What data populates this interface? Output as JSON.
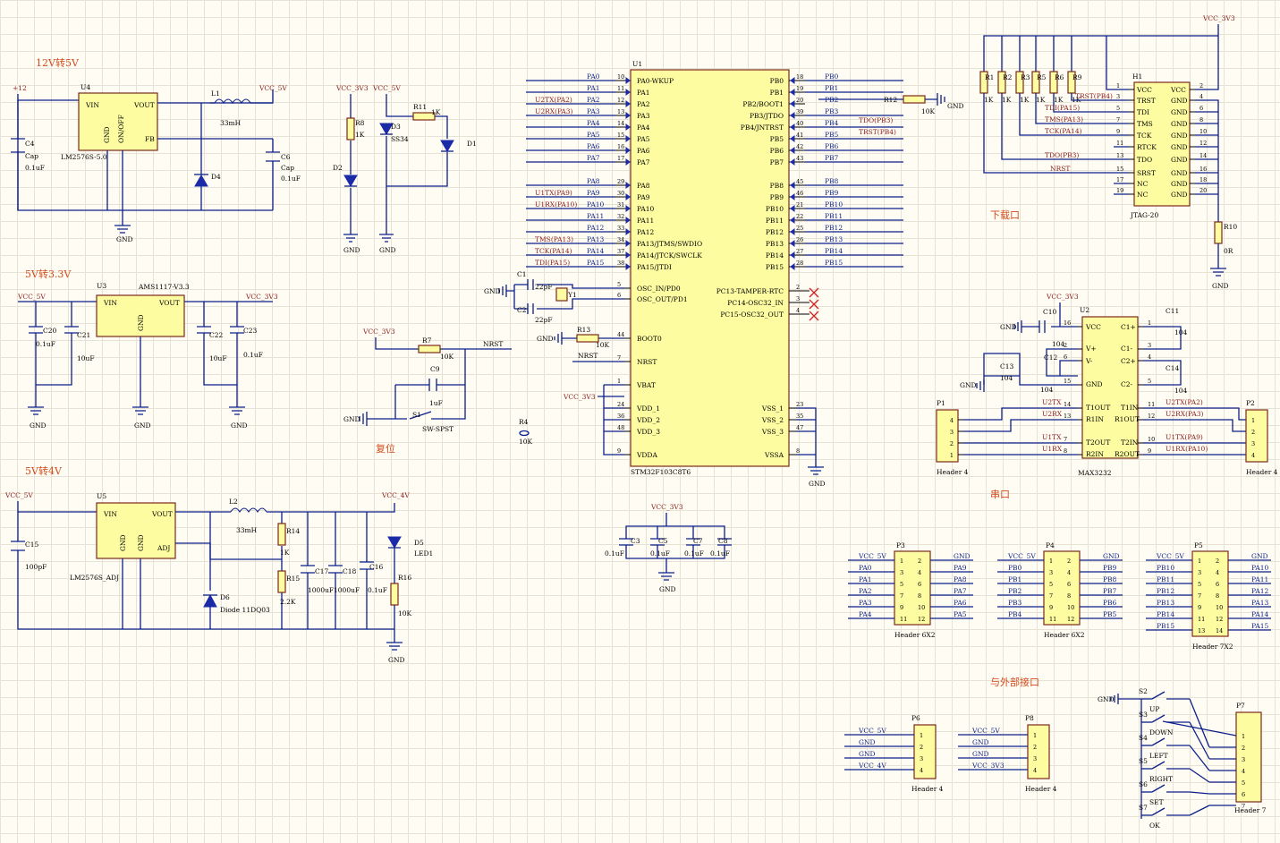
{
  "sections": {
    "s12v5v": "12V转5V",
    "s5v33": "5V转3.3V",
    "s5v4v": "5V转4V",
    "reset": "复位",
    "download": "下载口",
    "serial": "串口",
    "external": "与外部接口"
  },
  "nets": {
    "p12": "+12",
    "vcc5": "VCC_5V",
    "vcc33": "VCC_3V3",
    "vcc4": "VCC_4V",
    "gnd": "GND",
    "nrst": "NRST"
  },
  "u4": {
    "ref": "U4",
    "vin": "VIN",
    "vout": "VOUT",
    "fb": "FB",
    "gnd": "GND",
    "onoff": "ON/OFF",
    "part": "LM2576S-5.0"
  },
  "l1": {
    "ref": "L1",
    "value": "33mH"
  },
  "d4": {
    "ref": "D4"
  },
  "c4": {
    "ref": "C4",
    "type": "Cap",
    "value": "0.1uF"
  },
  "c6": {
    "ref": "C6",
    "type": "Cap",
    "value": "0.1uF"
  },
  "r8": {
    "ref": "R8",
    "value": "1K"
  },
  "d2": {
    "ref": "D2"
  },
  "d3": {
    "ref": "D3",
    "value": "SS34"
  },
  "r11": {
    "ref": "R11",
    "value": "1K"
  },
  "d1": {
    "ref": "D1"
  },
  "u3": {
    "ref": "U3",
    "part": "AMS1117-V3.3",
    "vin": "VIN",
    "vout": "VOUT",
    "gnd": "GND"
  },
  "c20": {
    "ref": "C20",
    "value": "0.1uF"
  },
  "c21": {
    "ref": "C21",
    "value": "10uF"
  },
  "c22": {
    "ref": "C22",
    "value": "10uF"
  },
  "c23": {
    "ref": "C23",
    "value": "0.1uF"
  },
  "u5": {
    "ref": "U5",
    "vin": "VIN",
    "vout": "VOUT",
    "adj": "ADJ",
    "gnd": "GND",
    "part": "LM2576S_ADJ"
  },
  "c15": {
    "ref": "C15",
    "value": "100pF"
  },
  "l2": {
    "ref": "L2",
    "value": "33mH"
  },
  "d6": {
    "ref": "D6",
    "value": "Diode 11DQ03"
  },
  "r14": {
    "ref": "R14",
    "value": "1K"
  },
  "r15": {
    "ref": "R15",
    "value": "2.2K"
  },
  "c17": {
    "ref": "C17",
    "value": "1000uF"
  },
  "c18": {
    "ref": "C18",
    "value": "1000uF"
  },
  "c16": {
    "ref": "C16",
    "value": "0.1uF"
  },
  "d5": {
    "ref": "D5",
    "value": "LED1"
  },
  "r16": {
    "ref": "R16",
    "value": "10K"
  },
  "r7": {
    "ref": "R7",
    "value": "10K"
  },
  "c9": {
    "ref": "C9",
    "value": "1uF"
  },
  "s1": {
    "ref": "S1",
    "type": "SW-SPST"
  },
  "r4": {
    "ref": "R4",
    "value": "10K"
  },
  "y1": {
    "ref": "Y1"
  },
  "c1": {
    "ref": "C1",
    "value": "22pF"
  },
  "c2": {
    "ref": "C2",
    "value": "22pF"
  },
  "r13": {
    "ref": "R13",
    "value": "10K"
  },
  "r12": {
    "ref": "R12",
    "value": "10K"
  },
  "c3": {
    "ref": "C3",
    "value": "0.1uF"
  },
  "c5": {
    "ref": "C5",
    "value": "0.1uF"
  },
  "c7": {
    "ref": "C7",
    "value": "0.1uF"
  },
  "c8": {
    "ref": "C8",
    "value": "0.1uF"
  },
  "u1": {
    "ref": "U1",
    "part": "STM32F103C8T6",
    "left": [
      {
        "num": "10",
        "name": "PA0-WKUP",
        "net": "PA0",
        "ext": ""
      },
      {
        "num": "11",
        "name": "PA1",
        "net": "PA1",
        "ext": ""
      },
      {
        "num": "12",
        "name": "PA2",
        "net": "PA2",
        "ext": "U2TX(PA2)"
      },
      {
        "num": "13",
        "name": "PA3",
        "net": "PA3",
        "ext": "U2RX(PA3)"
      },
      {
        "num": "14",
        "name": "PA4",
        "net": "PA4",
        "ext": ""
      },
      {
        "num": "15",
        "name": "PA5",
        "net": "PA5",
        "ext": ""
      },
      {
        "num": "16",
        "name": "PA6",
        "net": "PA6",
        "ext": ""
      },
      {
        "num": "17",
        "name": "PA7",
        "net": "PA7",
        "ext": ""
      },
      {
        "num": "29",
        "name": "PA8",
        "net": "PA8",
        "ext": ""
      },
      {
        "num": "30",
        "name": "PA9",
        "net": "PA9",
        "ext": "U1TX(PA9)"
      },
      {
        "num": "31",
        "name": "PA10",
        "net": "PA10",
        "ext": "U1RX(PA10)"
      },
      {
        "num": "32",
        "name": "PA11",
        "net": "PA11",
        "ext": ""
      },
      {
        "num": "33",
        "name": "PA12",
        "net": "PA12",
        "ext": ""
      },
      {
        "num": "34",
        "name": "PA13/JTMS/SWDIO",
        "net": "PA13",
        "ext": "TMS(PA13)"
      },
      {
        "num": "37",
        "name": "PA14/JTCK/SWCLK",
        "net": "PA14",
        "ext": "TCK(PA14)"
      },
      {
        "num": "38",
        "name": "PA15/JTDI",
        "net": "PA15",
        "ext": "TDI(PA15)"
      },
      {
        "num": "5",
        "name": "OSC_IN/PD0",
        "net": "",
        "ext": ""
      },
      {
        "num": "6",
        "name": "OSC_OUT/PD1",
        "net": "",
        "ext": ""
      },
      {
        "num": "44",
        "name": "BOOT0",
        "net": "",
        "ext": ""
      },
      {
        "num": "7",
        "name": "NRST",
        "net": "",
        "ext": ""
      },
      {
        "num": "1",
        "name": "VBAT",
        "net": "",
        "ext": ""
      },
      {
        "num": "24",
        "name": "VDD_1",
        "net": "",
        "ext": ""
      },
      {
        "num": "36",
        "name": "VDD_2",
        "net": "",
        "ext": ""
      },
      {
        "num": "48",
        "name": "VDD_3",
        "net": "",
        "ext": ""
      },
      {
        "num": "9",
        "name": "VDDA",
        "net": "",
        "ext": ""
      }
    ],
    "right": [
      {
        "num": "18",
        "name": "PB0",
        "net": "PB0",
        "ext": ""
      },
      {
        "num": "19",
        "name": "PB1",
        "net": "PB1",
        "ext": ""
      },
      {
        "num": "20",
        "name": "PB2/BOOT1",
        "net": "PB2",
        "ext": ""
      },
      {
        "num": "39",
        "name": "PB3/JTDO",
        "net": "PB3",
        "ext": "TDO(PB3)"
      },
      {
        "num": "40",
        "name": "PB4/JNTRST",
        "net": "PB4",
        "ext": "TRST(PB4)"
      },
      {
        "num": "41",
        "name": "PB5",
        "net": "PB5",
        "ext": ""
      },
      {
        "num": "42",
        "name": "PB6",
        "net": "PB6",
        "ext": ""
      },
      {
        "num": "43",
        "name": "PB7",
        "net": "PB7",
        "ext": ""
      },
      {
        "num": "45",
        "name": "PB8",
        "net": "PB8",
        "ext": ""
      },
      {
        "num": "46",
        "name": "PB9",
        "net": "PB9",
        "ext": ""
      },
      {
        "num": "21",
        "name": "PB10",
        "net": "PB10",
        "ext": ""
      },
      {
        "num": "22",
        "name": "PB11",
        "net": "PB11",
        "ext": ""
      },
      {
        "num": "25",
        "name": "PB12",
        "net": "PB12",
        "ext": ""
      },
      {
        "num": "26",
        "name": "PB13",
        "net": "PB13",
        "ext": ""
      },
      {
        "num": "27",
        "name": "PB14",
        "net": "PB14",
        "ext": ""
      },
      {
        "num": "28",
        "name": "PB15",
        "net": "PB15",
        "ext": ""
      },
      {
        "num": "2",
        "name": "PC13-TAMPER-RTC",
        "net": "",
        "ext": ""
      },
      {
        "num": "3",
        "name": "PC14-OSC32_IN",
        "net": "",
        "ext": ""
      },
      {
        "num": "4",
        "name": "PC15-OSC32_OUT",
        "net": "",
        "ext": ""
      },
      {
        "num": "23",
        "name": "VSS_1",
        "net": "",
        "ext": ""
      },
      {
        "num": "35",
        "name": "VSS_2",
        "net": "",
        "ext": ""
      },
      {
        "num": "47",
        "name": "VSS_3",
        "net": "",
        "ext": ""
      },
      {
        "num": "8",
        "name": "VSSA",
        "net": "",
        "ext": ""
      }
    ]
  },
  "jtag": {
    "ref": "H1",
    "part": "JTAG-20",
    "r1": "R1",
    "r2": "R2",
    "r3": "R3",
    "r5": "R5",
    "r6": "R6",
    "r9": "R9",
    "rval": "1K",
    "left": [
      {
        "num": "1",
        "name": "VCC",
        "net": ""
      },
      {
        "num": "3",
        "name": "TRST",
        "net": "TRST(PB4)"
      },
      {
        "num": "5",
        "name": "TDI",
        "net": "TDI(PA15)"
      },
      {
        "num": "7",
        "name": "TMS",
        "net": "TMS(PA13)"
      },
      {
        "num": "9",
        "name": "TCK",
        "net": "TCK(PA14)"
      },
      {
        "num": "11",
        "name": "RTCK",
        "net": ""
      },
      {
        "num": "13",
        "name": "TDO",
        "net": "TDO(PB3)"
      },
      {
        "num": "15",
        "name": "SRST",
        "net": "NRST"
      },
      {
        "num": "17",
        "name": "NC",
        "net": ""
      },
      {
        "num": "19",
        "name": "NC",
        "net": ""
      }
    ],
    "right": [
      {
        "num": "2",
        "name": "VCC"
      },
      {
        "num": "4",
        "name": "GND"
      },
      {
        "num": "6",
        "name": "GND"
      },
      {
        "num": "8",
        "name": "GND"
      },
      {
        "num": "10",
        "name": "GND"
      },
      {
        "num": "12",
        "name": "GND"
      },
      {
        "num": "14",
        "name": "GND"
      },
      {
        "num": "16",
        "name": "GND"
      },
      {
        "num": "18",
        "name": "GND"
      },
      {
        "num": "20",
        "name": "GND"
      }
    ]
  },
  "r10": {
    "ref": "R10",
    "value": "0R"
  },
  "c10": {
    "ref": "C10",
    "value": "104"
  },
  "c11": {
    "ref": "C11",
    "value": "104"
  },
  "c12": {
    "ref": "C12",
    "value": "104"
  },
  "c13": {
    "ref": "C13",
    "value": "104"
  },
  "c14": {
    "ref": "C14",
    "value": "104"
  },
  "u2": {
    "ref": "U2",
    "part": "MAX3232",
    "vcc": "VCC",
    "vp": "V+",
    "vm": "V-",
    "gnd": "GND",
    "t1out": "T1OUT",
    "r1in": "R1IN",
    "t2out": "T2OUT",
    "r2in": "R2IN",
    "c1p": "C1+",
    "c1m": "C1-",
    "c2p": "C2+",
    "c2m": "C2-",
    "t1in": "T1IN",
    "r1out": "R1OUT",
    "t2in": "T2IN",
    "r2out": "R2OUT",
    "n_u2tx": "U2TX",
    "n_u2rx": "U2RX",
    "n_u1tx": "U1TX",
    "n_u1rx": "U1RX",
    "n_u2txp": "U2TX(PA2)",
    "n_u2rxp": "U2RX(PA3)",
    "n_u1txp": "U1TX(PA9)",
    "n_u1rxp": "U1RX(PA10)",
    "pins_left": [
      "16",
      "2",
      "6",
      "15",
      "14",
      "13",
      "7",
      "8"
    ],
    "pins_right": [
      "1",
      "3",
      "4",
      "5",
      "11",
      "12",
      "10",
      "9"
    ]
  },
  "serial": {
    "p1": "P1",
    "p2": "P2",
    "header": "Header 4",
    "p1_pins": [
      "4",
      "3",
      "2",
      "1"
    ],
    "p2_pins": [
      "1",
      "2",
      "3",
      "4"
    ]
  },
  "gpio": [
    {
      "ref": "P3",
      "part": "Header 6X2",
      "left": [
        "VCC_5V",
        "PA0",
        "PA1",
        "PA2",
        "PA3",
        "PA4"
      ],
      "right": [
        "GND",
        "PA9",
        "PA8",
        "PA7",
        "PA6",
        "PA5"
      ],
      "odd": [
        "1",
        "3",
        "5",
        "7",
        "9",
        "11"
      ],
      "even": [
        "2",
        "4",
        "6",
        "8",
        "10",
        "12"
      ]
    },
    {
      "ref": "P4",
      "part": "Header 6X2",
      "left": [
        "VCC_5V",
        "PB0",
        "PB1",
        "PB2",
        "PB3",
        "PB4"
      ],
      "right": [
        "GND",
        "PB9",
        "PB8",
        "PB7",
        "PB6",
        "PB5"
      ],
      "odd": [
        "1",
        "3",
        "5",
        "7",
        "9",
        "11"
      ],
      "even": [
        "2",
        "4",
        "6",
        "8",
        "10",
        "12"
      ]
    },
    {
      "ref": "P5",
      "part": "Header 7X2",
      "left": [
        "VCC_5V",
        "PB10",
        "PB11",
        "PB12",
        "PB13",
        "PB14",
        "PB15"
      ],
      "right": [
        "GND",
        "PA10",
        "PA11",
        "PA12",
        "PA13",
        "PA14",
        "PA15"
      ],
      "odd": [
        "1",
        "3",
        "5",
        "7",
        "9",
        "11",
        "13"
      ],
      "even": [
        "2",
        "4",
        "6",
        "8",
        "10",
        "12",
        "14"
      ]
    }
  ],
  "ext_headers": [
    {
      "ref": "P6",
      "part": "Header 4",
      "nets": [
        "VCC_5V",
        "GND",
        "GND",
        "VCC_4V"
      ],
      "pins": [
        "1",
        "2",
        "3",
        "4"
      ]
    },
    {
      "ref": "P8",
      "part": "Header 4",
      "nets": [
        "VCC_5V",
        "GND",
        "GND",
        "VCC_3V3"
      ],
      "pins": [
        "1",
        "2",
        "3",
        "4"
      ]
    }
  ],
  "buttons": {
    "ref": "P7",
    "part": "Header 7",
    "gnd": "GND",
    "pins": [
      "1",
      "2",
      "3",
      "4",
      "5",
      "6",
      "7"
    ],
    "items": [
      {
        "ref": "S2",
        "label": "UP"
      },
      {
        "ref": "S3",
        "label": "DOWN"
      },
      {
        "ref": "S4",
        "label": "LEFT"
      },
      {
        "ref": "S5",
        "label": "RIGHT"
      },
      {
        "ref": "S6",
        "label": "SET"
      },
      {
        "ref": "S7",
        "label": "OK"
      }
    ]
  }
}
